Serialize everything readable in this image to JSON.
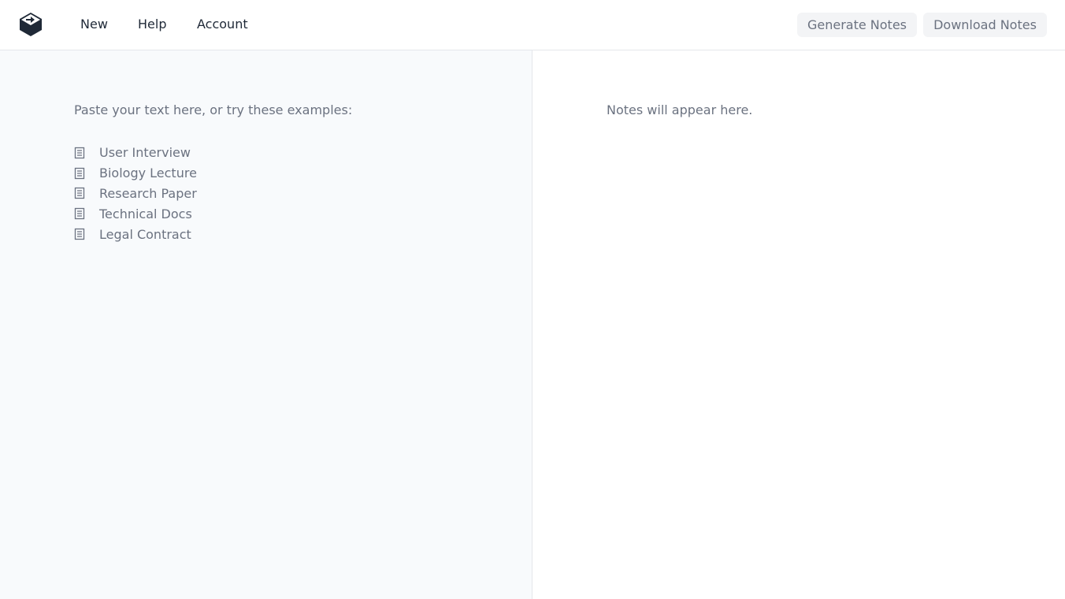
{
  "nav": {
    "new": "New",
    "help": "Help",
    "account": "Account"
  },
  "toolbar": {
    "generate": "Generate Notes",
    "download": "Download Notes"
  },
  "input": {
    "prompt": "Paste your text here, or try these examples:",
    "examples": [
      {
        "label": "User Interview",
        "icon": "document-icon"
      },
      {
        "label": "Biology Lecture",
        "icon": "document-icon"
      },
      {
        "label": "Research Paper",
        "icon": "document-icon"
      },
      {
        "label": "Technical Docs",
        "icon": "document-icon"
      },
      {
        "label": "Legal Contract",
        "icon": "document-icon"
      }
    ]
  },
  "output": {
    "placeholder": "Notes will appear here."
  }
}
